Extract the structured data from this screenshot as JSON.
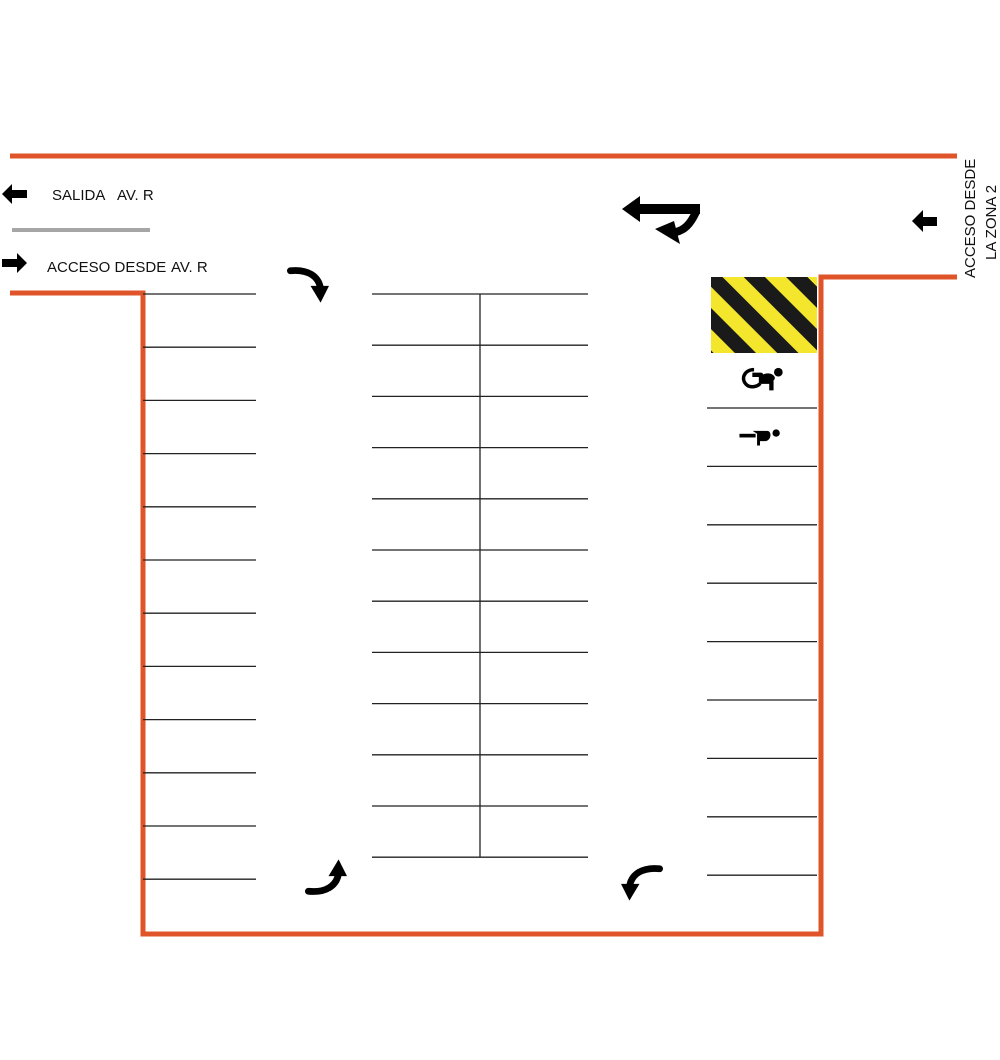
{
  "labels": {
    "exit": "SALIDA",
    "exit_road": "AV. R",
    "entry": "ACCESO DESDE",
    "entry_road": "AV. R",
    "zone_access_line1": "ACCESO DESDE",
    "zone_access_line2": "LA ZONA 2"
  },
  "colors": {
    "wall": "#e0542a",
    "divider": "#a6a6a6",
    "line": "#222222",
    "hazard_yellow": "#f3e62c",
    "hazard_black": "#1a1a1a",
    "arrow": "#000000"
  },
  "icons": {
    "exit_arrow": "arrow-left-icon",
    "entry_arrow": "arrow-right-icon",
    "zone_arrow": "arrow-left-icon",
    "turn_arrow": "left-and-down-turn-arrow-icon",
    "circulation": [
      "curved-arrow-down-icon",
      "curved-arrow-up-icon",
      "curved-arrow-down-left-icon"
    ],
    "accessible_1": "wheelchair-icon",
    "accessible_2": "wheelchair-icon"
  },
  "hazard_zone": "hazard-stripes"
}
